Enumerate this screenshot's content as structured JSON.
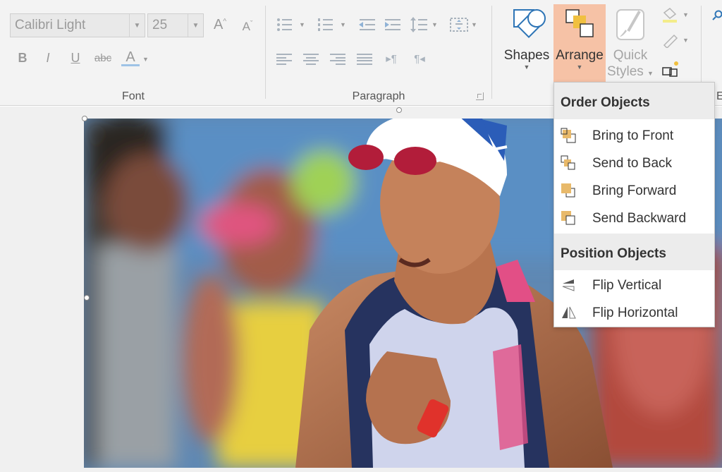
{
  "ribbon": {
    "font_group": {
      "label": "Font",
      "font_name": "Calibri Light",
      "font_size": "25",
      "grow_label": "A",
      "shrink_label": "A",
      "bold": "B",
      "italic": "I",
      "underline": "U",
      "strikethrough": "abc",
      "font_color": "A",
      "accent": "#9ec3e6"
    },
    "paragraph_group": {
      "label": "Paragraph"
    },
    "arrange_group": {
      "shapes_label": "Shapes",
      "arrange_label": "Arrange",
      "quick_styles_line1": "Quick",
      "quick_styles_line2": "Styles",
      "active_color": "#f6c2a6"
    }
  },
  "arrange_menu": {
    "order_header": "Order Objects",
    "order_items": [
      {
        "label": "Bring to Front",
        "icon": "bring-to-front-icon"
      },
      {
        "label": "Send to Back",
        "icon": "send-to-back-icon"
      },
      {
        "label": "Bring Forward",
        "icon": "bring-forward-icon"
      },
      {
        "label": "Send Backward",
        "icon": "send-backward-icon"
      }
    ],
    "position_header": "Position Objects",
    "position_items": [
      {
        "label": "Flip Vertical",
        "icon": "flip-vertical-icon"
      },
      {
        "label": "Flip Horizontal",
        "icon": "flip-horizontal-icon"
      }
    ],
    "icon_color": "#e8b96a"
  },
  "slide": {
    "image_description_icon": "athlete-photo"
  }
}
